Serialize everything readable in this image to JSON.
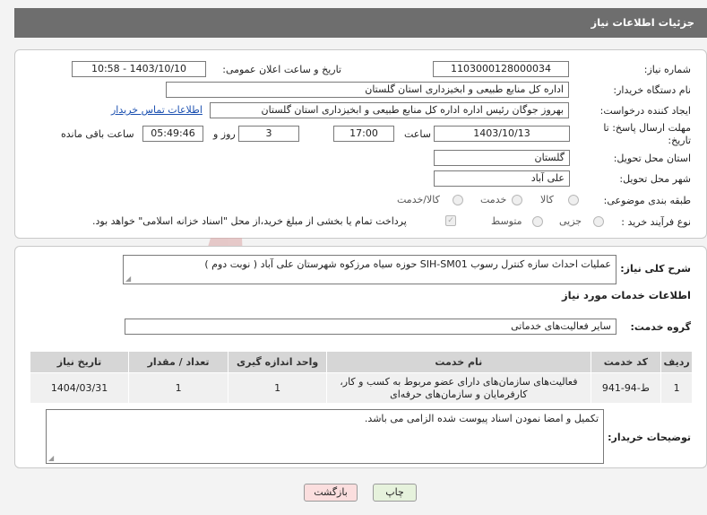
{
  "header": {
    "title": "جزئیات اطلاعات نیاز"
  },
  "form": {
    "need_number_label": "شماره نیاز:",
    "need_number": "1103000128000034",
    "announce_label": "تاریخ و ساعت اعلان عمومی:",
    "announce_value": "1403/10/10 - 10:58",
    "buyer_label": "نام دستگاه خریدار:",
    "buyer_value": "اداره کل منابع طبیعی و ابخیزداری استان گلستان",
    "creator_label": "ایجاد کننده درخواست:",
    "creator_value": "بهروز جوگان رئیس اداره اداره کل منابع طبیعی و ابخیزداری استان گلستان",
    "contact_link": "اطلاعات تماس خریدار",
    "deadline_label_1": "مهلت ارسال پاسخ: تا",
    "deadline_label_2": "تاریخ:",
    "deadline_date": "1403/10/13",
    "time_label": "ساعت",
    "deadline_time": "17:00",
    "days_value": "3",
    "days_label": "روز و",
    "remaining_time": "05:49:46",
    "remaining_label": "ساعت باقی مانده",
    "province_label": "استان محل تحویل:",
    "province_value": "گلستان",
    "city_label": "شهر محل تحویل:",
    "city_value": "علی آباد",
    "category_label": "طبقه بندی موضوعی:",
    "category_options": [
      "کالا",
      "خدمت",
      "کالا/خدمت"
    ],
    "process_label": "نوع فرآیند خرید :",
    "process_options": [
      "جزیی",
      "متوسط"
    ],
    "payment_note": "پرداخت تمام یا بخشی از مبلغ خرید،از محل \"اسناد خزانه اسلامی\" خواهد بود."
  },
  "details": {
    "summary_label": "شرح کلی نیاز:",
    "summary_value": "عملیات احداث سازه کنترل رسوب SIH-SM01 حوزه سیاه مرزکوه شهرستان علی آباد ( نوبت دوم )",
    "services_title": "اطلاعات خدمات مورد نیاز",
    "group_label": "گروه خدمت:",
    "group_value": "سایر فعالیت‌های خدماتی",
    "table": {
      "headers": [
        "ردیف",
        "کد خدمت",
        "نام خدمت",
        "واحد اندازه گیری",
        "تعداد / مقدار",
        "تاریخ نیاز"
      ],
      "rows": [
        [
          "1",
          "ط-94-941",
          "فعالیت‌های سازمان‌های دارای عضو مربوط به کسب و کار، کارفرمایان و سازمان‌های حرفه‌ای",
          "1",
          "1",
          "1404/03/31"
        ]
      ]
    },
    "buyer_notes_label": "توضیحات خریدار:",
    "buyer_notes_value": "تکمیل و امضا نمودن اسناد پیوست شده الزامی می باشد."
  },
  "buttons": {
    "print": "چاپ",
    "back": "بازگشت"
  },
  "watermark": {
    "text": "AriaTender.neT",
    "color": "#d9a3a3"
  }
}
